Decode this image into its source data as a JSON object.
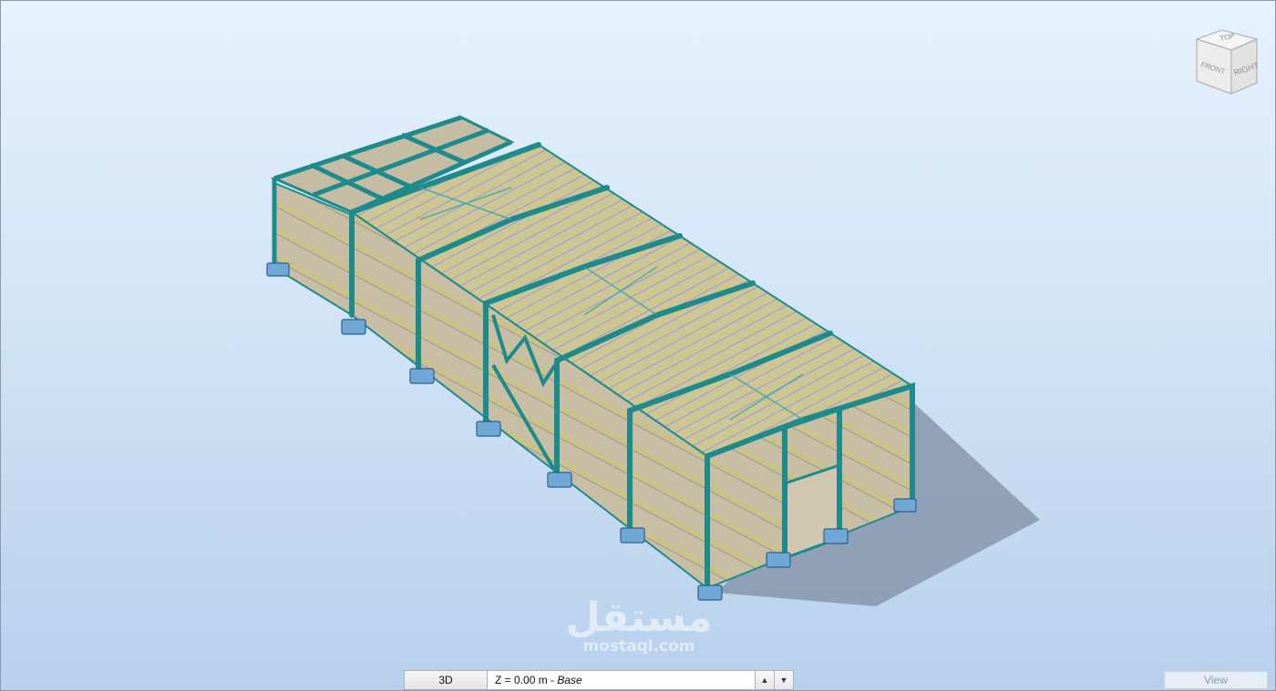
{
  "viewcube": {
    "top_label": "TOP",
    "front_label": "FRONT",
    "right_label": "RIGHT"
  },
  "watermark": {
    "main": "مستقل",
    "sub": "mostaql.com"
  },
  "bottom_bar": {
    "view_mode": "3D",
    "level_prefix": "Z = 0.00 m - ",
    "level_name": "Base",
    "up_icon": "arrow-up-icon",
    "down_icon": "arrow-down-icon"
  },
  "view_button": {
    "label": "View"
  },
  "colors": {
    "frame": "#1e8a8c",
    "panel": "#c9c0a6",
    "purlin": "#c8c440",
    "footing": "#6fa7d6",
    "shadow": "#8594a8"
  }
}
